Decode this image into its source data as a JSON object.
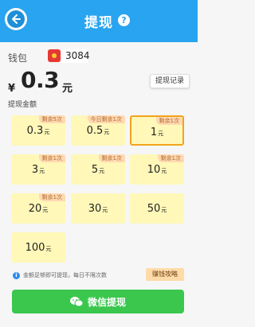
{
  "header": {
    "title": "提现",
    "help_glyph": "?",
    "back_icon": "back-arrow-icon",
    "color": "#29a4f0"
  },
  "wallet": {
    "label": "钱包",
    "icon": "red-envelope-icon",
    "value": "3084"
  },
  "balance": {
    "currency": "¥",
    "amount": "0.3",
    "unit": "元",
    "record_button": "提现记录"
  },
  "amounts_section": {
    "label": "提现金额",
    "options": [
      {
        "value": "0.3",
        "unit": "元",
        "badge": "剩余5次",
        "selected": false
      },
      {
        "value": "0.5",
        "unit": "元",
        "badge": "今日剩余1次",
        "selected": false
      },
      {
        "value": "1",
        "unit": "元",
        "badge": "剩余1次",
        "selected": true
      },
      {
        "value": "3",
        "unit": "元",
        "badge": "剩余1次",
        "selected": false
      },
      {
        "value": "5",
        "unit": "元",
        "badge": "剩余1次",
        "selected": false
      },
      {
        "value": "10",
        "unit": "元",
        "badge": "剩余1次",
        "selected": false
      },
      {
        "value": "20",
        "unit": "元",
        "badge": "剩余1次",
        "selected": false
      },
      {
        "value": "30",
        "unit": "元",
        "badge": "",
        "selected": false
      },
      {
        "value": "50",
        "unit": "元",
        "badge": "",
        "selected": false
      },
      {
        "value": "100",
        "unit": "元",
        "badge": "",
        "selected": false
      }
    ]
  },
  "tip": {
    "icon_glyph": "i",
    "text": "金额足够即可提现，每日不限次数",
    "earn_button": "赚钱攻略"
  },
  "submit": {
    "icon": "wechat-icon",
    "label": "微信提现",
    "color": "#3bc74e"
  }
}
